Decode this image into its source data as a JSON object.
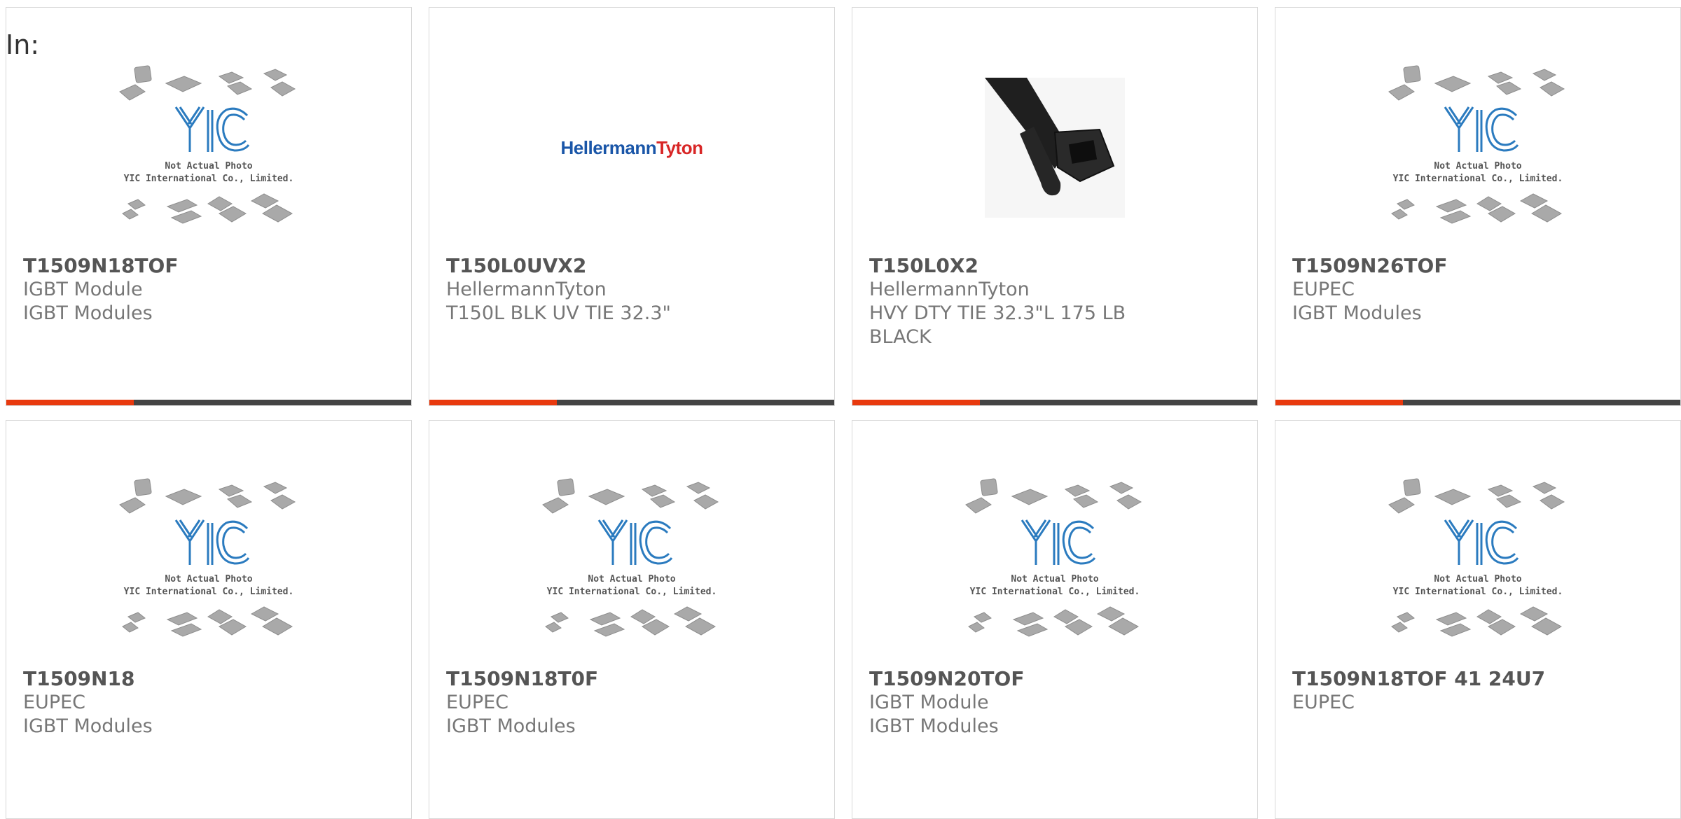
{
  "header": {
    "in_label": "In:"
  },
  "placeholder": {
    "line1": "Not Actual Photo",
    "line2": "YIC International Co., Limited.",
    "logo": "YIC"
  },
  "brand_logo": {
    "part1": "Hellermann",
    "part2": "Tyton"
  },
  "colors": {
    "accent": "#e8390e",
    "bar": "#444444",
    "yic_blue": "#2b7bbf"
  },
  "products": [
    {
      "part_number": "T1509N18TOF",
      "lines": [
        "IGBT Module",
        "IGBT Modules"
      ],
      "image": "yic-placeholder",
      "show_bar": true
    },
    {
      "part_number": "T150L0UVX2",
      "lines": [
        "HellermannTyton",
        "T150L BLK UV TIE 32.3\""
      ],
      "image": "hellermanntyton-logo",
      "show_bar": true
    },
    {
      "part_number": "T150L0X2",
      "lines": [
        "HellermannTyton",
        "HVY DTY TIE 32.3\"L 175 LB",
        "BLACK"
      ],
      "image": "cable-tie-photo",
      "show_bar": true
    },
    {
      "part_number": "T1509N26TOF",
      "lines": [
        "EUPEC",
        "IGBT Modules"
      ],
      "image": "yic-placeholder",
      "show_bar": true
    },
    {
      "part_number": "T1509N18",
      "lines": [
        "EUPEC",
        "IGBT Modules"
      ],
      "image": "yic-placeholder",
      "show_bar": false
    },
    {
      "part_number": "T1509N18T0F",
      "lines": [
        "EUPEC",
        "IGBT Modules"
      ],
      "image": "yic-placeholder",
      "show_bar": false
    },
    {
      "part_number": "T1509N20TOF",
      "lines": [
        "IGBT Module",
        "IGBT Modules"
      ],
      "image": "yic-placeholder",
      "show_bar": false
    },
    {
      "part_number": "T1509N18TOF 41 24U7",
      "lines": [
        "EUPEC"
      ],
      "image": "yic-placeholder",
      "show_bar": false
    }
  ]
}
